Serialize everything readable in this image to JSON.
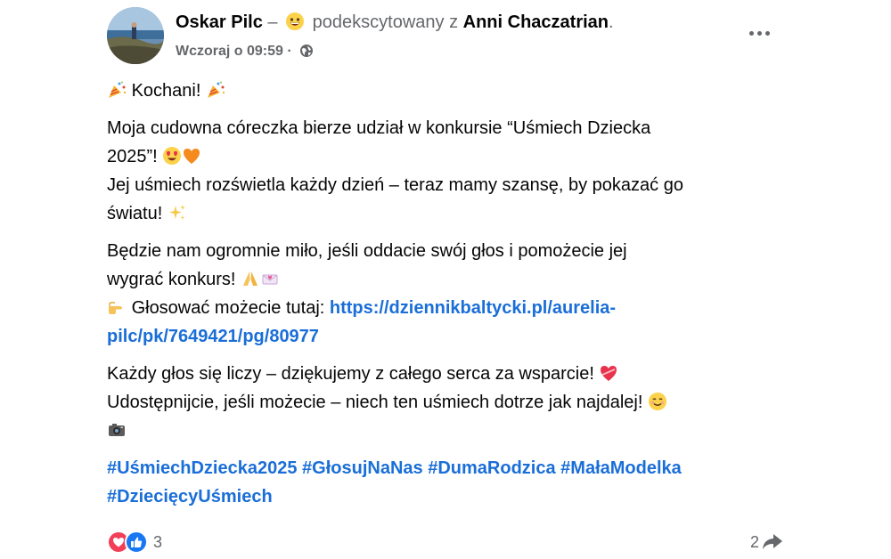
{
  "post": {
    "author": "Oskar Pilc",
    "separator": "–",
    "feeling": "podekscytowany z",
    "tagged": "Anni Chaczatrian",
    "period": ".",
    "timestamp": "Wczoraj o 09:59",
    "dot": "·",
    "privacy_icon": "globe-icon",
    "more_icon": "more-options-icon"
  },
  "content": {
    "p1": {
      "text": "Kochani!",
      "emoji": "party-popper"
    },
    "p2": {
      "line1": "Moja cudowna córeczka bierze udział w konkursie “Uśmiech Dziecka",
      "line2": "2025”!",
      "line3": "Jej uśmiech rozświetla każdy dzień – teraz mamy szansę, by pokazać go",
      "line4": "światu!"
    },
    "p3": {
      "line1": "Będzie nam ogromnie miło, jeśli oddacie swój głos i pomożecie jej",
      "line2": "wygrać konkurs!",
      "line3": "Głosować możecie tutaj:",
      "link_part1": "https://dziennikbaltycki.pl/aurelia-",
      "link_part2": "pilc/pk/7649421/pg/80977"
    },
    "p4": {
      "line1": "Każdy głos się liczy – dziękujemy z całego serca za wsparcie!",
      "line2": "Udostępnijcie, jeśli możecie – niech ten uśmiech dotrze jak najdalej!"
    },
    "hashtags": {
      "h1": "#UśmiechDziecka2025",
      "h2": "#GłosujNaNas",
      "h3": "#DumaRodzica",
      "h4": "#MałaModelka",
      "h5": "#DziecięcyUśmiech"
    }
  },
  "footer": {
    "reaction_count": "3",
    "share_count": "2",
    "reaction_icons": [
      "love-icon",
      "like-icon"
    ],
    "share_icon": "share-arrow-icon"
  },
  "colors": {
    "link": "#1a6ed8",
    "secondary_text": "#65676b",
    "love": "#f33e58",
    "like": "#1877f2"
  }
}
